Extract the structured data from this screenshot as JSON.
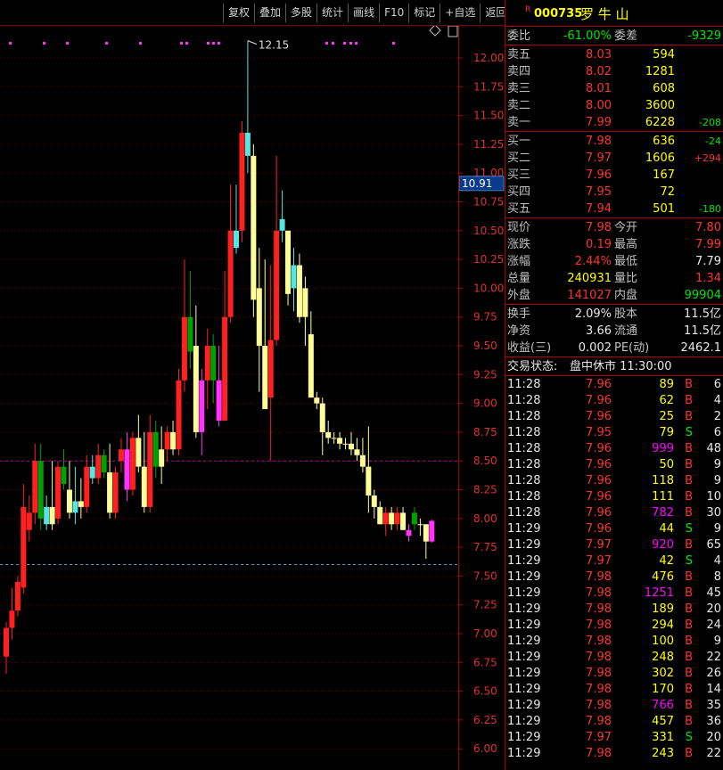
{
  "toolbar": {
    "buttons": [
      "复权",
      "叠加",
      "多股",
      "统计",
      "画线",
      "F10",
      "标记",
      "+自选",
      "返回"
    ]
  },
  "stock": {
    "badge": "R",
    "code": "000735",
    "name": "罗 牛 山"
  },
  "weibi": {
    "label": "委比",
    "value": "-61.00%",
    "diff_label": "委差",
    "diff": "-9329"
  },
  "asks": [
    {
      "label": "卖五",
      "price": "8.03",
      "vol": "594",
      "chg": ""
    },
    {
      "label": "卖四",
      "price": "8.02",
      "vol": "1281",
      "chg": ""
    },
    {
      "label": "卖三",
      "price": "8.01",
      "vol": "608",
      "chg": ""
    },
    {
      "label": "卖二",
      "price": "8.00",
      "vol": "3600",
      "chg": ""
    },
    {
      "label": "卖一",
      "price": "7.99",
      "vol": "6228",
      "chg": "-208"
    }
  ],
  "bids": [
    {
      "label": "买一",
      "price": "7.98",
      "vol": "636",
      "chg": "-24"
    },
    {
      "label": "买二",
      "price": "7.97",
      "vol": "1606",
      "chg": "+294"
    },
    {
      "label": "买三",
      "price": "7.96",
      "vol": "167",
      "chg": ""
    },
    {
      "label": "买四",
      "price": "7.95",
      "vol": "72",
      "chg": ""
    },
    {
      "label": "买五",
      "price": "7.94",
      "vol": "501",
      "chg": "-180"
    }
  ],
  "quote": [
    {
      "l1": "现价",
      "v1": "7.98",
      "l2": "今开",
      "v2": "7.80"
    },
    {
      "l1": "涨跌",
      "v1": "0.19",
      "l2": "最高",
      "v2": "7.99"
    },
    {
      "l1": "涨幅",
      "v1": "2.44%",
      "l2": "最低",
      "v2": "7.79"
    },
    {
      "l1": "总量",
      "v1": "240931",
      "l2": "量比",
      "v2": "1.34"
    },
    {
      "l1": "外盘",
      "v1": "141027",
      "l2": "内盘",
      "v2": "99904"
    }
  ],
  "finance": [
    {
      "l1": "换手",
      "v1": "2.09%",
      "l2": "股本",
      "v2": "11.5亿"
    },
    {
      "l1": "净资",
      "v1": "3.66",
      "l2": "流通",
      "v2": "11.5亿"
    },
    {
      "l1": "收益(三)",
      "v1": "0.002",
      "l2": "PE(动)",
      "v2": "2462.1"
    }
  ],
  "trade_status": {
    "label": "交易状态:",
    "value": "盘中休市 11:30:00"
  },
  "ticks": [
    {
      "t": "11:28",
      "p": "7.96",
      "v": "89",
      "s": "B",
      "n": "6"
    },
    {
      "t": "11:28",
      "p": "7.96",
      "v": "62",
      "s": "B",
      "n": "4"
    },
    {
      "t": "11:28",
      "p": "7.96",
      "v": "25",
      "s": "B",
      "n": "2"
    },
    {
      "t": "11:28",
      "p": "7.95",
      "v": "79",
      "s": "S",
      "n": "6"
    },
    {
      "t": "11:28",
      "p": "7.96",
      "v": "999",
      "s": "B",
      "n": "48"
    },
    {
      "t": "11:28",
      "p": "7.96",
      "v": "50",
      "s": "B",
      "n": "9"
    },
    {
      "t": "11:28",
      "p": "7.96",
      "v": "118",
      "s": "B",
      "n": "9"
    },
    {
      "t": "11:28",
      "p": "7.96",
      "v": "111",
      "s": "B",
      "n": "10"
    },
    {
      "t": "11:28",
      "p": "7.96",
      "v": "782",
      "s": "B",
      "n": "30"
    },
    {
      "t": "11:29",
      "p": "7.96",
      "v": "44",
      "s": "S",
      "n": "9"
    },
    {
      "t": "11:29",
      "p": "7.97",
      "v": "920",
      "s": "B",
      "n": "65"
    },
    {
      "t": "11:29",
      "p": "7.97",
      "v": "42",
      "s": "S",
      "n": "4"
    },
    {
      "t": "11:29",
      "p": "7.98",
      "v": "476",
      "s": "B",
      "n": "8"
    },
    {
      "t": "11:29",
      "p": "7.98",
      "v": "1251",
      "s": "B",
      "n": "45"
    },
    {
      "t": "11:29",
      "p": "7.98",
      "v": "189",
      "s": "B",
      "n": "20"
    },
    {
      "t": "11:29",
      "p": "7.98",
      "v": "294",
      "s": "B",
      "n": "24"
    },
    {
      "t": "11:29",
      "p": "7.98",
      "v": "100",
      "s": "B",
      "n": "9"
    },
    {
      "t": "11:29",
      "p": "7.98",
      "v": "248",
      "s": "B",
      "n": "22"
    },
    {
      "t": "11:29",
      "p": "7.98",
      "v": "302",
      "s": "B",
      "n": "26"
    },
    {
      "t": "11:29",
      "p": "7.98",
      "v": "170",
      "s": "B",
      "n": "14"
    },
    {
      "t": "11:29",
      "p": "7.98",
      "v": "766",
      "s": "B",
      "n": "35"
    },
    {
      "t": "11:29",
      "p": "7.98",
      "v": "457",
      "s": "B",
      "n": "36"
    },
    {
      "t": "11:29",
      "p": "7.97",
      "v": "331",
      "s": "S",
      "n": "20"
    },
    {
      "t": "11:29",
      "p": "7.98",
      "v": "243",
      "s": "B",
      "n": "22"
    }
  ],
  "chart_data": {
    "type": "candlestick",
    "y_ticks": [
      "12.00",
      "11.75",
      "11.50",
      "11.25",
      "11.00",
      "10.75",
      "10.50",
      "10.25",
      "10.00",
      "9.75",
      "9.50",
      "9.25",
      "9.00",
      "8.75",
      "8.50",
      "8.25",
      "8.00",
      "7.75",
      "7.50",
      "7.25",
      "7.00",
      "6.75",
      "6.50",
      "6.25",
      "6.00"
    ],
    "ylim": [
      5.8,
      12.3
    ],
    "current_price_label": "10.91",
    "high_annotation": "12.15",
    "reference_lines": [
      8.5,
      7.6
    ],
    "colors": {
      "up": "#ff2020",
      "down": "#00a000",
      "yellow": "#ffff99",
      "cyan": "#55e5e5",
      "magenta": "#ff33ff",
      "grid": "#6a0000",
      "axis_text": "#e03030"
    },
    "candles": [
      {
        "o": 6.8,
        "h": 7.1,
        "l": 6.65,
        "c": 7.05,
        "k": "up"
      },
      {
        "o": 7.05,
        "h": 7.4,
        "l": 6.95,
        "c": 7.2,
        "k": "up"
      },
      {
        "o": 7.2,
        "h": 7.5,
        "l": 7.15,
        "c": 7.45,
        "k": "up"
      },
      {
        "o": 7.4,
        "h": 8.3,
        "l": 7.35,
        "c": 8.1,
        "k": "up"
      },
      {
        "o": 7.9,
        "h": 8.2,
        "l": 7.8,
        "c": 8.05,
        "k": "up"
      },
      {
        "o": 8.05,
        "h": 8.65,
        "l": 7.95,
        "c": 8.5,
        "k": "up"
      },
      {
        "o": 8.5,
        "h": 8.65,
        "l": 7.9,
        "c": 8.0,
        "k": "down"
      },
      {
        "o": 7.95,
        "h": 8.2,
        "l": 7.9,
        "c": 8.1,
        "k": "cyan"
      },
      {
        "o": 8.1,
        "h": 8.5,
        "l": 7.9,
        "c": 7.95,
        "k": "yellow"
      },
      {
        "o": 8.0,
        "h": 8.5,
        "l": 7.95,
        "c": 8.45,
        "k": "up"
      },
      {
        "o": 8.45,
        "h": 8.6,
        "l": 8.25,
        "c": 8.3,
        "k": "down"
      },
      {
        "o": 8.25,
        "h": 8.5,
        "l": 8.0,
        "c": 8.05,
        "k": "yellow"
      },
      {
        "o": 8.05,
        "h": 8.45,
        "l": 7.95,
        "c": 8.15,
        "k": "cyan"
      },
      {
        "o": 8.15,
        "h": 8.35,
        "l": 8.0,
        "c": 8.1,
        "k": "yellow"
      },
      {
        "o": 8.1,
        "h": 8.55,
        "l": 8.05,
        "c": 8.45,
        "k": "up"
      },
      {
        "o": 8.45,
        "h": 8.55,
        "l": 8.3,
        "c": 8.35,
        "k": "cyan"
      },
      {
        "o": 8.35,
        "h": 8.65,
        "l": 8.3,
        "c": 8.55,
        "k": "up"
      },
      {
        "o": 8.55,
        "h": 8.6,
        "l": 8.35,
        "c": 8.4,
        "k": "down"
      },
      {
        "o": 8.4,
        "h": 8.65,
        "l": 8.0,
        "c": 8.05,
        "k": "yellow"
      },
      {
        "o": 8.05,
        "h": 8.45,
        "l": 8.0,
        "c": 8.4,
        "k": "up"
      },
      {
        "o": 8.5,
        "h": 8.7,
        "l": 8.4,
        "c": 8.6,
        "k": "up"
      },
      {
        "o": 8.6,
        "h": 8.75,
        "l": 8.15,
        "c": 8.25,
        "k": "magenta"
      },
      {
        "o": 8.25,
        "h": 8.75,
        "l": 8.2,
        "c": 8.7,
        "k": "up"
      },
      {
        "o": 8.7,
        "h": 8.9,
        "l": 8.4,
        "c": 8.45,
        "k": "yellow"
      },
      {
        "o": 8.45,
        "h": 8.75,
        "l": 8.05,
        "c": 8.1,
        "k": "yellow"
      },
      {
        "o": 8.1,
        "h": 8.9,
        "l": 8.05,
        "c": 8.75,
        "k": "up"
      },
      {
        "o": 8.75,
        "h": 8.85,
        "l": 8.35,
        "c": 8.45,
        "k": "down"
      },
      {
        "o": 8.45,
        "h": 8.8,
        "l": 8.3,
        "c": 8.6,
        "k": "yellow"
      },
      {
        "o": 8.6,
        "h": 8.8,
        "l": 8.5,
        "c": 8.75,
        "k": "up"
      },
      {
        "o": 8.75,
        "h": 8.85,
        "l": 8.55,
        "c": 8.6,
        "k": "yellow"
      },
      {
        "o": 8.6,
        "h": 9.3,
        "l": 8.55,
        "c": 9.2,
        "k": "up"
      },
      {
        "o": 9.2,
        "h": 10.25,
        "l": 9.1,
        "c": 9.75,
        "k": "up"
      },
      {
        "o": 9.75,
        "h": 10.15,
        "l": 9.3,
        "c": 9.45,
        "k": "down"
      },
      {
        "o": 9.5,
        "h": 9.85,
        "l": 8.7,
        "c": 8.75,
        "k": "yellow"
      },
      {
        "o": 8.75,
        "h": 9.3,
        "l": 8.55,
        "c": 9.2,
        "k": "magenta"
      },
      {
        "o": 9.2,
        "h": 9.65,
        "l": 8.95,
        "c": 9.5,
        "k": "up"
      },
      {
        "o": 9.5,
        "h": 9.6,
        "l": 9.0,
        "c": 9.2,
        "k": "down"
      },
      {
        "o": 9.2,
        "h": 9.5,
        "l": 8.8,
        "c": 8.85,
        "k": "magenta"
      },
      {
        "o": 8.85,
        "h": 10.15,
        "l": 8.85,
        "c": 9.75,
        "k": "up"
      },
      {
        "o": 9.75,
        "h": 10.9,
        "l": 9.7,
        "c": 10.5,
        "k": "up"
      },
      {
        "o": 10.35,
        "h": 10.9,
        "l": 10.3,
        "c": 10.5,
        "k": "cyan"
      },
      {
        "o": 10.5,
        "h": 11.45,
        "l": 10.4,
        "c": 11.35,
        "k": "up"
      },
      {
        "o": 11.35,
        "h": 12.15,
        "l": 11.0,
        "c": 11.15,
        "k": "cyan"
      },
      {
        "o": 11.15,
        "h": 11.25,
        "l": 9.75,
        "c": 9.9,
        "k": "yellow"
      },
      {
        "o": 10.0,
        "h": 10.35,
        "l": 9.1,
        "c": 9.5,
        "k": "yellow"
      },
      {
        "o": 9.5,
        "h": 10.25,
        "l": 8.95,
        "c": 8.95,
        "k": "yellow"
      },
      {
        "o": 9.05,
        "h": 10.2,
        "l": 8.5,
        "c": 9.55,
        "k": "up"
      },
      {
        "o": 9.55,
        "h": 11.15,
        "l": 9.5,
        "c": 10.5,
        "k": "up"
      },
      {
        "o": 10.6,
        "h": 10.85,
        "l": 10.4,
        "c": 10.5,
        "k": "cyan"
      },
      {
        "o": 10.5,
        "h": 10.5,
        "l": 9.85,
        "c": 9.95,
        "k": "yellow"
      },
      {
        "o": 10.0,
        "h": 10.35,
        "l": 9.8,
        "c": 10.2,
        "k": "cyan"
      },
      {
        "o": 10.2,
        "h": 10.3,
        "l": 9.7,
        "c": 9.75,
        "k": "yellow"
      },
      {
        "o": 9.75,
        "h": 10.1,
        "l": 9.5,
        "c": 10.0,
        "k": "yellow"
      },
      {
        "o": 9.6,
        "h": 9.8,
        "l": 9.05,
        "c": 9.05,
        "k": "yellow"
      },
      {
        "o": 9.05,
        "h": 9.1,
        "l": 8.95,
        "c": 9.0,
        "k": "yellow"
      },
      {
        "o": 9.0,
        "h": 9.05,
        "l": 8.55,
        "c": 8.75,
        "k": "yellow"
      },
      {
        "o": 8.75,
        "h": 8.85,
        "l": 8.65,
        "c": 8.7,
        "k": "yellow"
      },
      {
        "o": 8.7,
        "h": 8.75,
        "l": 8.65,
        "c": 8.7,
        "k": "yellow"
      },
      {
        "o": 8.7,
        "h": 8.75,
        "l": 8.6,
        "c": 8.65,
        "k": "yellow"
      },
      {
        "o": 8.65,
        "h": 8.7,
        "l": 8.6,
        "c": 8.65,
        "k": "yellow"
      },
      {
        "o": 8.65,
        "h": 8.75,
        "l": 8.55,
        "c": 8.6,
        "k": "yellow"
      },
      {
        "o": 8.6,
        "h": 8.7,
        "l": 8.5,
        "c": 8.55,
        "k": "yellow"
      },
      {
        "o": 8.55,
        "h": 8.7,
        "l": 8.4,
        "c": 8.45,
        "k": "yellow"
      },
      {
        "o": 8.45,
        "h": 8.8,
        "l": 8.05,
        "c": 8.2,
        "k": "yellow"
      },
      {
        "o": 8.2,
        "h": 8.25,
        "l": 8.0,
        "c": 8.1,
        "k": "yellow"
      },
      {
        "o": 8.1,
        "h": 8.15,
        "l": 7.95,
        "c": 7.95,
        "k": "yellow"
      },
      {
        "o": 7.95,
        "h": 8.1,
        "l": 7.85,
        "c": 8.05,
        "k": "up"
      },
      {
        "o": 8.05,
        "h": 8.1,
        "l": 7.9,
        "c": 7.95,
        "k": "yellow"
      },
      {
        "o": 7.95,
        "h": 8.1,
        "l": 7.9,
        "c": 8.05,
        "k": "up"
      },
      {
        "o": 8.05,
        "h": 8.1,
        "l": 7.9,
        "c": 7.9,
        "k": "yellow"
      },
      {
        "o": 7.85,
        "h": 7.95,
        "l": 7.8,
        "c": 7.9,
        "k": "magenta"
      },
      {
        "o": 8.05,
        "h": 8.1,
        "l": 7.9,
        "c": 7.95,
        "k": "down"
      },
      {
        "o": 7.95,
        "h": 8.0,
        "l": 7.85,
        "c": 7.95,
        "k": "yellow"
      },
      {
        "o": 7.95,
        "h": 7.95,
        "l": 7.65,
        "c": 7.8,
        "k": "yellow"
      },
      {
        "o": 7.8,
        "h": 7.99,
        "l": 7.79,
        "c": 7.98,
        "k": "magenta"
      }
    ]
  }
}
